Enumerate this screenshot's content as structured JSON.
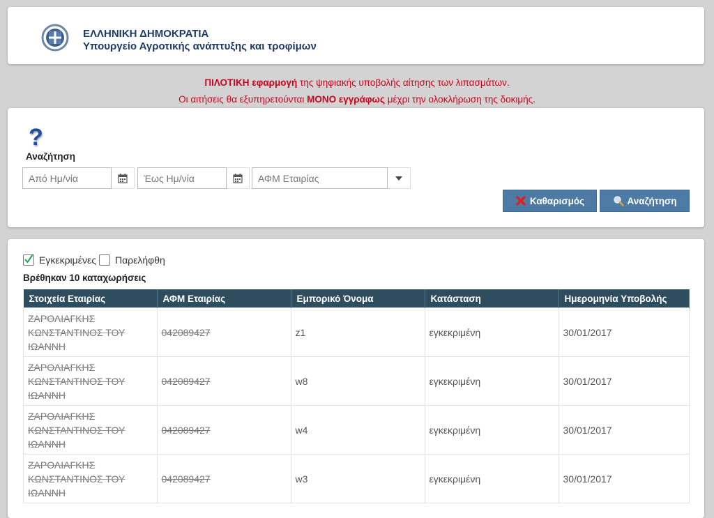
{
  "header": {
    "title": "ΕΛΛΗΝΙΚΗ ΔΗΜΟΚΡΑΤΙΑ",
    "subtitle": "Υπουργείο Αγροτικής ανάπτυξης και τροφίμων"
  },
  "notice": {
    "line1_bold": "ΠΙΛΟΤΙΚΗ εφαρμογή",
    "line1_rest": " της ψηφιακής υποβολής αίτησης των λιπασμάτων.",
    "line2_pre": "Οι αιτήσεις θα εξυπηρετούνται ",
    "line2_bold": "ΜΟΝΟ εγγράφως",
    "line2_post": " μέχρι την ολοκλήρωση της δοκιμής."
  },
  "search": {
    "label": "Αναζήτηση",
    "from_placeholder": "Από Ημ/νία",
    "to_placeholder": "Έως Ημ/νία",
    "afm_placeholder": "ΑΦΜ Εταιρίας",
    "clear_label": "Καθαρισμός",
    "search_label": "Αναζήτηση"
  },
  "filters": {
    "approved_label": "Εγκεκριμένες",
    "approved_checked": true,
    "received_label": "Παρελήφθη",
    "received_checked": false
  },
  "results": {
    "count_text": "Βρέθηκαν 10 καταχωρήσεις",
    "columns": [
      "Στοιχεία Εταιρίας",
      "ΑΦΜ Εταιρίας",
      "Εμπορικό Όνομα",
      "Κατάσταση",
      "Ημερομηνία Υποβολής"
    ],
    "rows": [
      {
        "company": "ΖΑΡΟΛΙΑΓΚΗΣ ΚΩΝΣΤΑΝΤΙΝΟΣ ΤΟΥ ΙΩΑΝΝΗ",
        "afm": "042089427",
        "trade_name": "z1",
        "status": "εγκεκριμένη",
        "date": "30/01/2017"
      },
      {
        "company": "ΖΑΡΟΛΙΑΓΚΗΣ ΚΩΝΣΤΑΝΤΙΝΟΣ ΤΟΥ ΙΩΑΝΝΗ",
        "afm": "042089427",
        "trade_name": "w8",
        "status": "εγκεκριμένη",
        "date": "30/01/2017"
      },
      {
        "company": "ΖΑΡΟΛΙΑΓΚΗΣ ΚΩΝΣΤΑΝΤΙΝΟΣ ΤΟΥ ΙΩΑΝΝΗ",
        "afm": "042089427",
        "trade_name": "w4",
        "status": "εγκεκριμένη",
        "date": "30/01/2017"
      },
      {
        "company": "ΖΑΡΟΛΙΑΓΚΗΣ ΚΩΝΣΤΑΝΤΙΝΟΣ ΤΟΥ ΙΩΑΝΝΗ",
        "afm": "042089427",
        "trade_name": "w3",
        "status": "εγκεκριμένη",
        "date": "30/01/2017"
      }
    ]
  },
  "colors": {
    "accent": "#4e7ba6",
    "table_header": "#2e4e60",
    "notice": "#d0021b",
    "title": "#1f3a68"
  }
}
